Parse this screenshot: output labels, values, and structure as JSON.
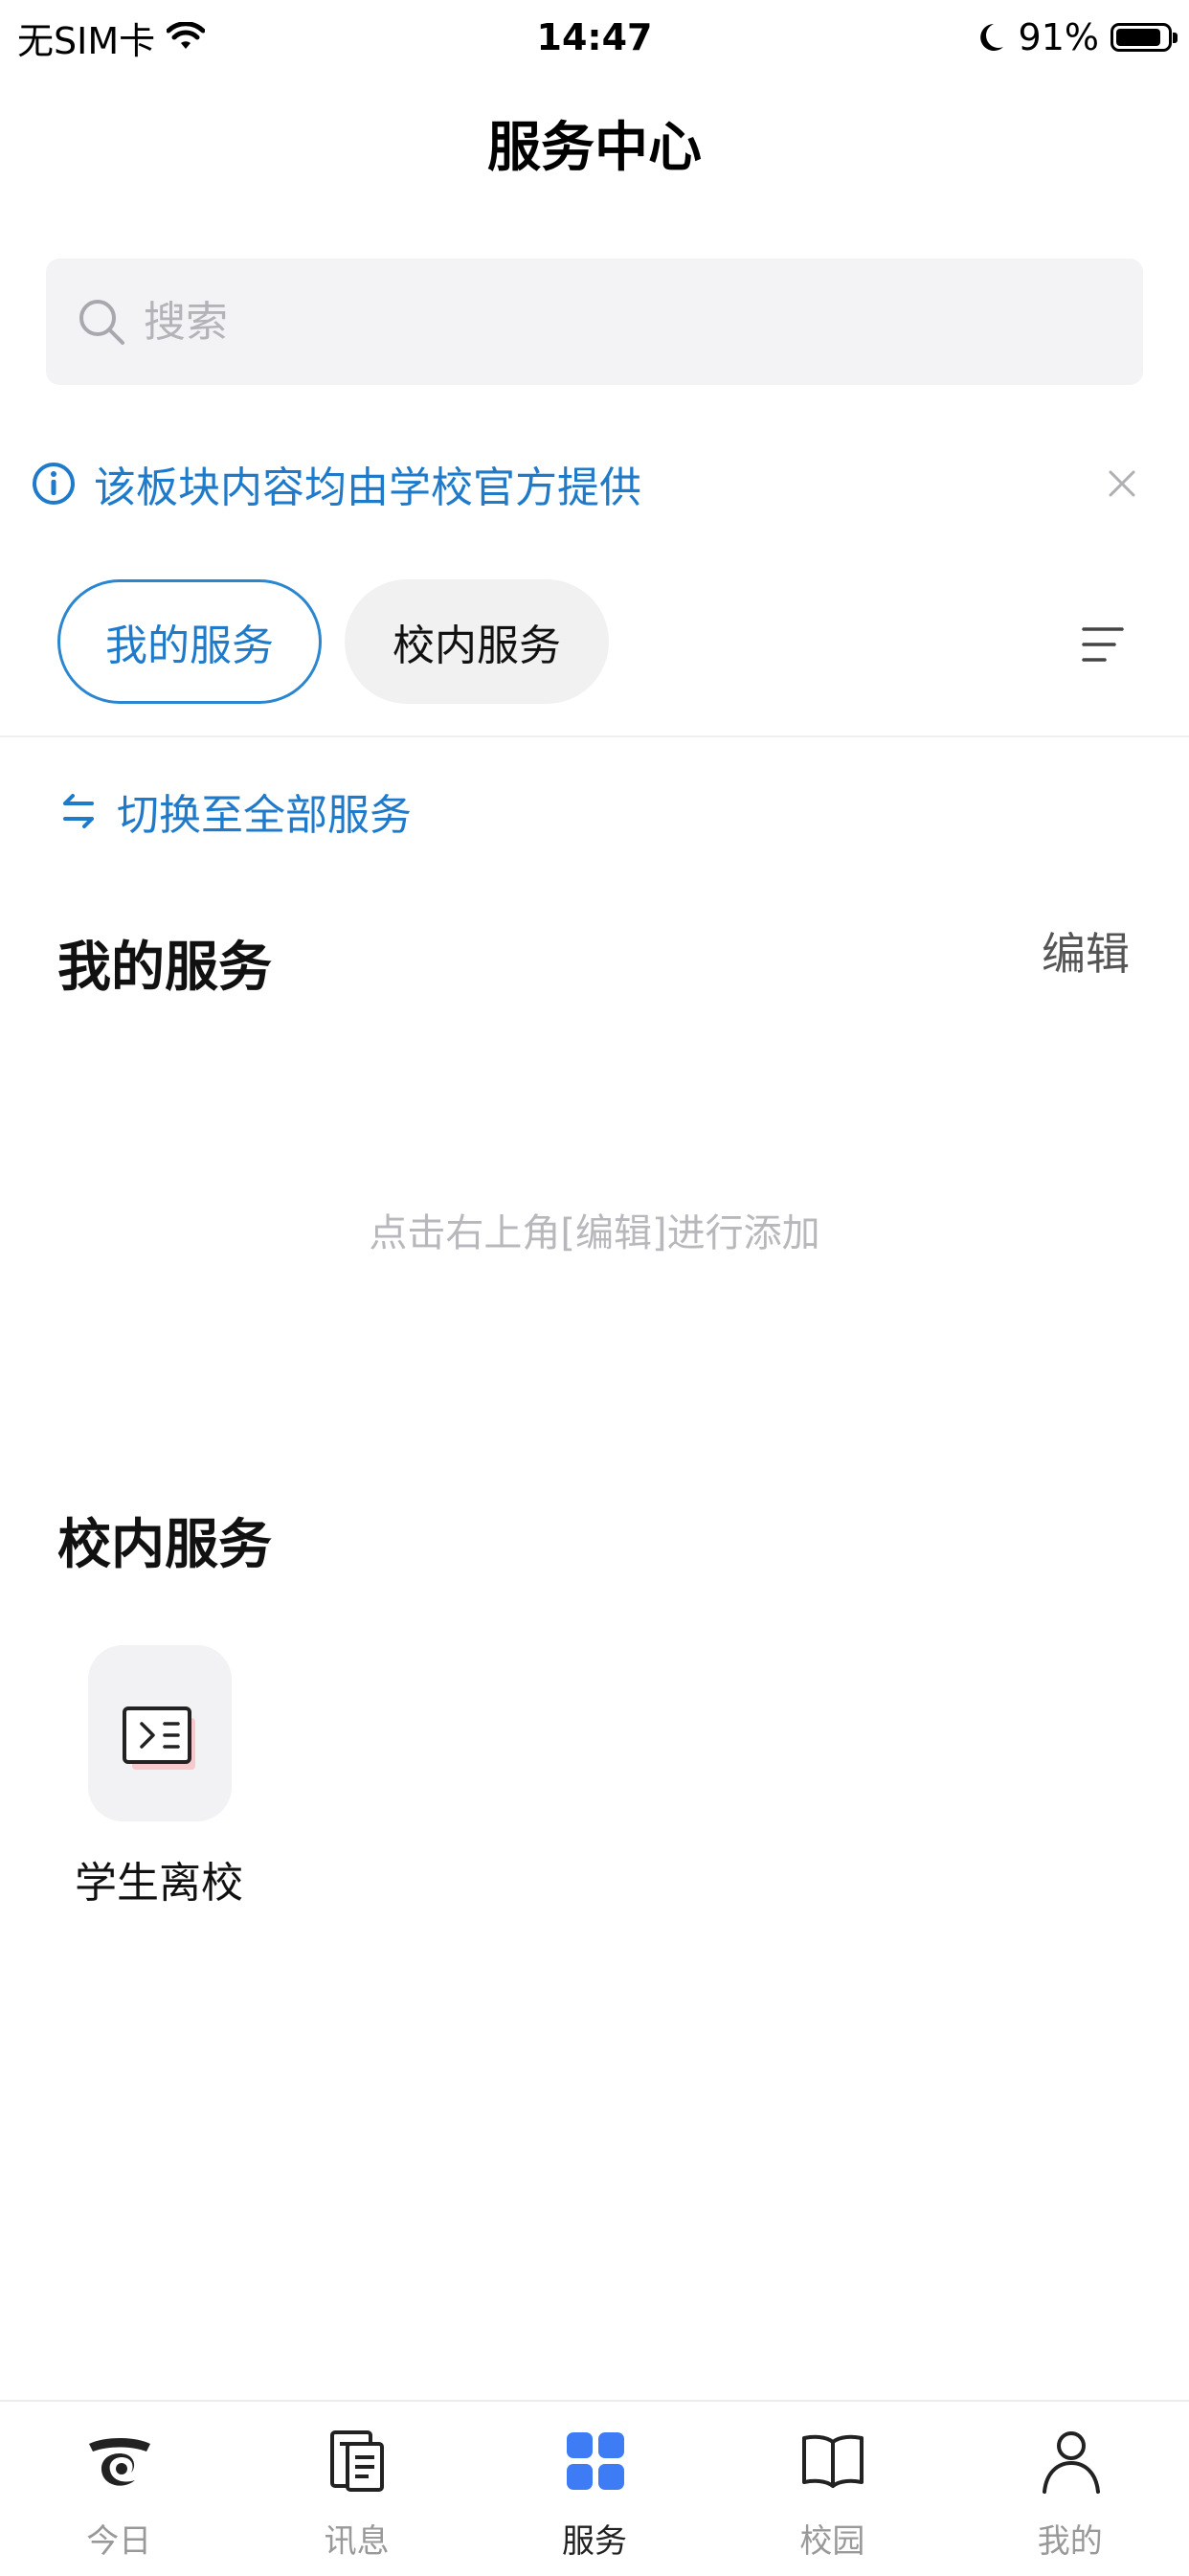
{
  "status_bar": {
    "carrier": "无SIM卡",
    "time": "14:47",
    "battery": "91%"
  },
  "header": {
    "title": "服务中心"
  },
  "search": {
    "placeholder": "搜索"
  },
  "notice": {
    "text": "该板块内容均由学校官方提供"
  },
  "tabs": [
    {
      "label": "我的服务",
      "active": true
    },
    {
      "label": "校内服务",
      "active": false
    }
  ],
  "switch_link": {
    "label": "切换至全部服务"
  },
  "my_services": {
    "title": "我的服务",
    "edit_label": "编辑",
    "empty_hint": "点击右上角[编辑]进行添加"
  },
  "campus_services": {
    "title": "校内服务",
    "items": [
      {
        "label": "学生离校",
        "icon": "student-leave-icon"
      }
    ]
  },
  "bottom_nav": [
    {
      "label": "今日",
      "icon": "today-logo-icon",
      "active": false
    },
    {
      "label": "讯息",
      "icon": "message-doc-icon",
      "active": false
    },
    {
      "label": "服务",
      "icon": "grid-icon",
      "active": true
    },
    {
      "label": "校园",
      "icon": "book-icon",
      "active": false
    },
    {
      "label": "我的",
      "icon": "person-icon",
      "active": false
    }
  ],
  "colors": {
    "accent": "#1f7ac9",
    "active_nav": "#3d7cf5",
    "inactive": "#999999"
  }
}
